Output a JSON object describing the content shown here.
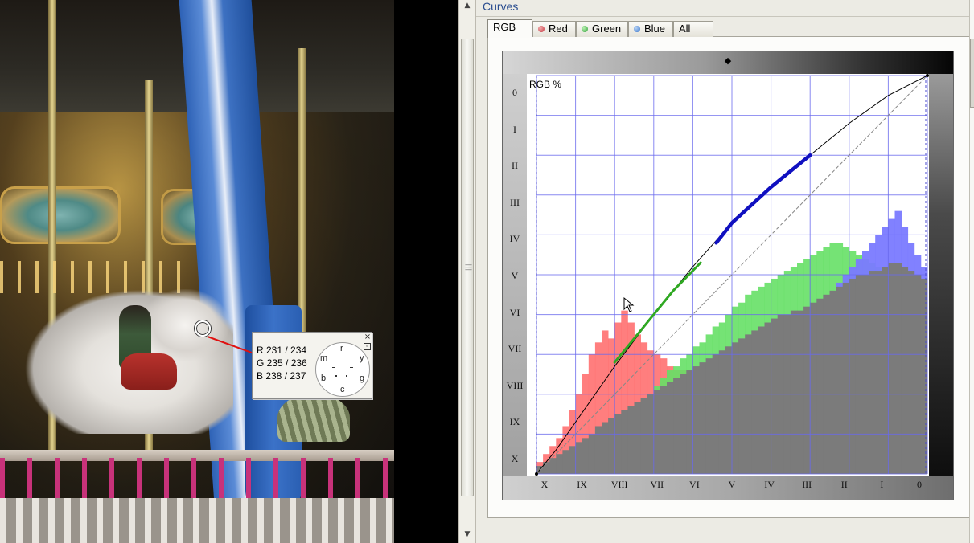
{
  "photo": {
    "description_icon": "photo-canvas"
  },
  "probe": {
    "rows": [
      "R 231 / 234",
      "G 235 / 236",
      "B 238 / 237"
    ],
    "dial_labels": {
      "top": "r",
      "top_right": "y",
      "right": "g",
      "bottom": "c",
      "bottom_left": "b",
      "top_left": "m"
    },
    "close_glyph": "×",
    "pin_glyph": "▫"
  },
  "panel": {
    "title": "Curves",
    "tabs": [
      {
        "label": "RGB",
        "active": true,
        "dot": null
      },
      {
        "label": "Red",
        "active": false,
        "dot": "#c0303a"
      },
      {
        "label": "Green",
        "active": false,
        "dot": "#2fa038"
      },
      {
        "label": "Blue",
        "active": false,
        "dot": "#2f6fc8"
      },
      {
        "label": "All",
        "active": false,
        "dot": null
      }
    ]
  },
  "chart_data": {
    "type": "line",
    "label": "RGB %",
    "y_ticks": [
      "0",
      "I",
      "II",
      "III",
      "IV",
      "V",
      "VI",
      "VII",
      "VIII",
      "IX",
      "X"
    ],
    "x_ticks": [
      "X",
      "IX",
      "VIII",
      "VII",
      "VI",
      "V",
      "IV",
      "III",
      "II",
      "I",
      "0"
    ],
    "xlim": [
      0,
      100
    ],
    "ylim": [
      0,
      100
    ],
    "grid": true,
    "series": [
      {
        "color": "#000000",
        "x": [
          0,
          5,
          10,
          20,
          30,
          40,
          50,
          60,
          70,
          80,
          90,
          100
        ],
        "y": [
          0,
          6,
          13,
          27,
          40,
          52,
          63,
          72,
          80,
          88,
          95,
          100
        ]
      },
      {
        "color": "#888888",
        "x": [
          0,
          100
        ],
        "y": [
          0,
          100
        ]
      },
      {
        "color": "#2fa822",
        "x": [
          20,
          25,
          30,
          35,
          40,
          42
        ],
        "y": [
          28,
          34,
          40,
          46,
          51,
          53
        ]
      },
      {
        "color": "#1010c0",
        "x": [
          46,
          50,
          55,
          60,
          65,
          70
        ],
        "y": [
          58,
          63,
          67.5,
          72,
          76,
          80
        ]
      }
    ],
    "histogram": {
      "gray": [
        2,
        3,
        4,
        5,
        6,
        7,
        8,
        9,
        10,
        12,
        13,
        14,
        15,
        16,
        17,
        18,
        19,
        20,
        21,
        22,
        23,
        24,
        25,
        26,
        27,
        28,
        29,
        30,
        31,
        32,
        33,
        34,
        35,
        36,
        37,
        38,
        39,
        40,
        40,
        41,
        41,
        42,
        43,
        44,
        45,
        46,
        47,
        48,
        49,
        50,
        50,
        51,
        51,
        52,
        53,
        53,
        52,
        51,
        50,
        49
      ],
      "red": [
        3,
        5,
        7,
        9,
        12,
        16,
        20,
        25,
        30,
        33,
        36,
        34,
        38,
        41,
        38,
        35,
        33,
        31,
        30,
        29,
        27,
        26,
        26,
        25,
        24,
        24,
        23,
        23,
        22,
        22,
        21,
        21,
        20,
        20,
        19,
        19,
        18,
        18,
        17,
        17,
        16,
        16,
        15,
        15,
        14,
        14,
        13,
        13,
        12,
        12,
        11,
        11,
        10,
        10,
        9,
        9,
        8,
        8,
        7,
        7
      ],
      "green": [
        1,
        2,
        3,
        4,
        5,
        6,
        7,
        8,
        9,
        11,
        12,
        13,
        14,
        15,
        16,
        17,
        19,
        20,
        22,
        24,
        26,
        27,
        29,
        30,
        32,
        33,
        35,
        37,
        38,
        40,
        42,
        43,
        45,
        46,
        47,
        48,
        49,
        50,
        51,
        52,
        53,
        54,
        55,
        56,
        57,
        58,
        58,
        57,
        56,
        55,
        54,
        53,
        52,
        51,
        50,
        49,
        48,
        47,
        46,
        45
      ],
      "blue": [
        1,
        1,
        2,
        2,
        3,
        3,
        4,
        4,
        5,
        5,
        6,
        6,
        7,
        7,
        8,
        8,
        9,
        9,
        10,
        10,
        11,
        11,
        12,
        12,
        13,
        13,
        14,
        14,
        15,
        15,
        16,
        17,
        18,
        19,
        20,
        21,
        22,
        24,
        26,
        28,
        30,
        33,
        36,
        39,
        42,
        45,
        48,
        50,
        52,
        54,
        56,
        58,
        60,
        62,
        64,
        66,
        62,
        58,
        55,
        52
      ]
    }
  }
}
